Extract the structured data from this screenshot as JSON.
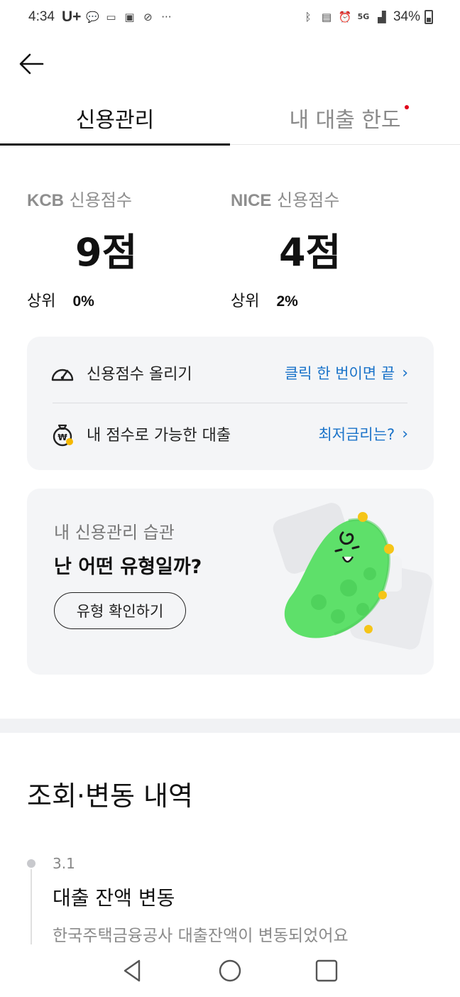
{
  "status_bar": {
    "time": "4:34",
    "carrier": "U+",
    "battery": "34%",
    "network": "5G"
  },
  "tabs": [
    {
      "label": "신용관리",
      "active": true
    },
    {
      "label": "내 대출 한도",
      "active": false,
      "has_dot": true
    }
  ],
  "scores": {
    "kcb": {
      "bureau": "KCB",
      "label": "신용점수",
      "value": "9점",
      "rank_label": "상위",
      "rank_value": "0%"
    },
    "nice": {
      "bureau": "NICE",
      "label": "신용점수",
      "value": "4점",
      "rank_label": "상위",
      "rank_value": "2%"
    }
  },
  "actions": [
    {
      "label": "신용점수 올리기",
      "link": "클릭 한 번이면 끝",
      "icon": "speedometer-icon"
    },
    {
      "label": "내 점수로 가능한 대출",
      "link": "최저금리는?",
      "icon": "money-bag-icon"
    }
  ],
  "habit_card": {
    "subtitle": "내 신용관리 습관",
    "title": "난 어떤 유형일까?",
    "button": "유형 확인하기"
  },
  "history": {
    "title": "조회·변동 내역",
    "items": [
      {
        "date": "3.1",
        "title": "대출 잔액 변동",
        "description": "한국주택금융공사 대출잔액이 변동되었어요"
      }
    ]
  },
  "colors": {
    "link": "#1a73c9",
    "card_bg": "#f4f5f7",
    "mascot": "#5ee06a",
    "dot": "#e0001a"
  }
}
